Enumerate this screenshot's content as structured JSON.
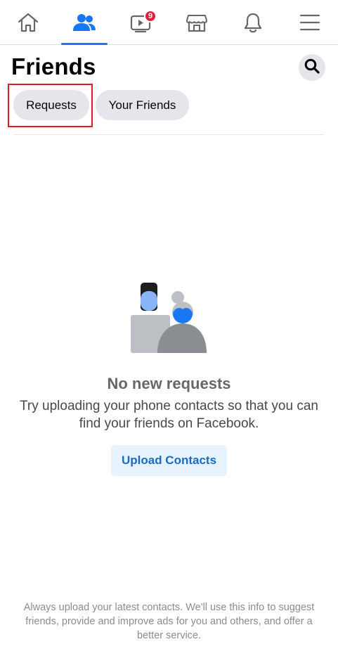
{
  "nav": {
    "tabs": [
      {
        "name": "home",
        "icon": "home-icon"
      },
      {
        "name": "friends",
        "icon": "friends-icon",
        "active": true
      },
      {
        "name": "watch",
        "icon": "video-icon",
        "badge": "9"
      },
      {
        "name": "marketplace",
        "icon": "marketplace-icon"
      },
      {
        "name": "notifications",
        "icon": "bell-icon"
      },
      {
        "name": "menu",
        "icon": "menu-icon"
      }
    ],
    "watch_badge": "9"
  },
  "header": {
    "title": "Friends",
    "search_icon": "search-icon"
  },
  "filters": {
    "requests_label": "Requests",
    "your_friends_label": "Your Friends"
  },
  "empty_state": {
    "title": "No new requests",
    "description": "Try uploading your phone contacts so that you can find your friends on Facebook.",
    "button_label": "Upload Contacts"
  },
  "footer": {
    "note": "Always upload your latest contacts. We'll use this info to suggest friends, provide and improve ads for you and others, and offer a better service."
  },
  "colors": {
    "accent": "#1877f2",
    "badge": "#e41e3f",
    "highlight": "#e0192c",
    "upload_bg": "#e7f3ff"
  }
}
